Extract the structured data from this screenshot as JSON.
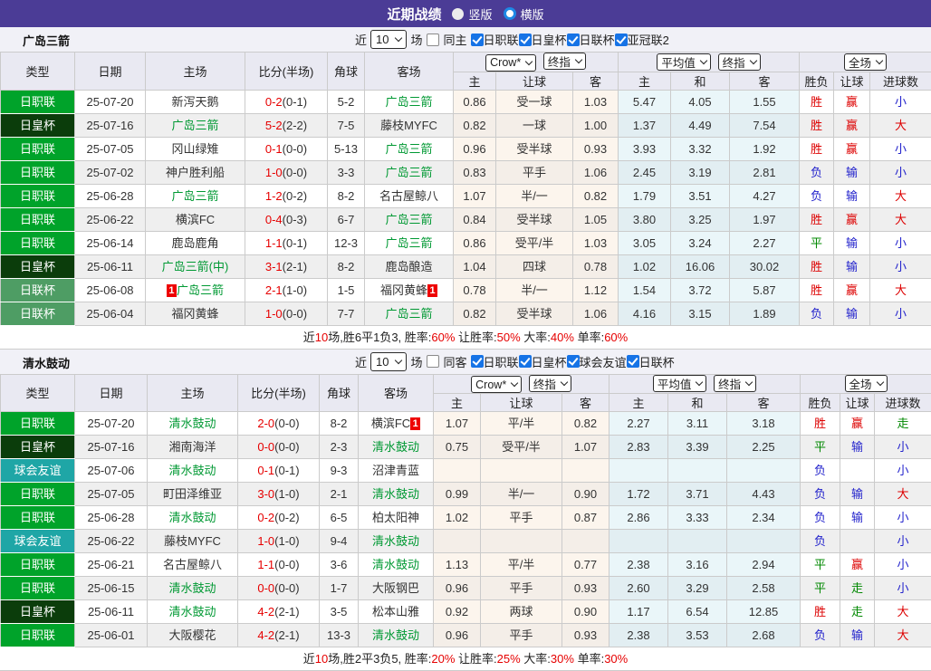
{
  "header": {
    "title": "近期战绩",
    "radio_vertical": "竖版",
    "radio_horizontal": "横版"
  },
  "labels": {
    "near": "近",
    "games": "场"
  },
  "league_colors": {
    "日职联": "#00A32A",
    "日皇杯": "#0B3D0B",
    "日联杯": "#4E9D64",
    "球会友谊": "#1FA6A6"
  },
  "result_colors": {
    "胜": "#DD0000",
    "赢": "#DD0000",
    "大": "#DD0000",
    "负": "#2222CC",
    "输": "#2222CC",
    "小": "#2222CC",
    "平": "#008800",
    "走": "#008800"
  },
  "table_head": {
    "match_cols": [
      "类型",
      "日期",
      "主场",
      "比分(半场)",
      "角球",
      "客场"
    ],
    "odds_selects": {
      "crow": "Crow*",
      "crow_final": "终指",
      "avg": "平均值",
      "avg_final": "终指",
      "full": "全场"
    },
    "sub_cols": [
      "主",
      "让球",
      "客",
      "主",
      "和",
      "客",
      "胜负",
      "让球",
      "进球数"
    ]
  },
  "sections": [
    {
      "team": "广岛三箭",
      "filter": {
        "count": "10",
        "same_label": "同主",
        "leagues": [
          "日职联",
          "日皇杯",
          "日联杯",
          "亚冠联2"
        ]
      },
      "rows": [
        {
          "league": "日职联",
          "date": "25-07-20",
          "home": {
            "name": "新泻天鹅"
          },
          "score": {
            "ft": "0-2",
            "ht": "(0-1)"
          },
          "corner": "5-2",
          "away": {
            "name": "广岛三箭",
            "focus": true
          },
          "crow": [
            "0.86",
            "受一球",
            "1.03"
          ],
          "avg": [
            "5.47",
            "4.05",
            "1.55"
          ],
          "result": [
            "胜",
            "赢",
            "小"
          ]
        },
        {
          "league": "日皇杯",
          "date": "25-07-16",
          "home": {
            "name": "广岛三箭",
            "focus": true
          },
          "score": {
            "ft": "5-2",
            "ht": "(2-2)"
          },
          "corner": "7-5",
          "away": {
            "name": "藤枝MYFC"
          },
          "crow": [
            "0.82",
            "一球",
            "1.00"
          ],
          "avg": [
            "1.37",
            "4.49",
            "7.54"
          ],
          "result": [
            "胜",
            "赢",
            "大"
          ]
        },
        {
          "league": "日职联",
          "date": "25-07-05",
          "home": {
            "name": "冈山绿雉"
          },
          "score": {
            "ft": "0-1",
            "ht": "(0-0)"
          },
          "corner": "5-13",
          "away": {
            "name": "广岛三箭",
            "focus": true
          },
          "crow": [
            "0.96",
            "受半球",
            "0.93"
          ],
          "avg": [
            "3.93",
            "3.32",
            "1.92"
          ],
          "result": [
            "胜",
            "赢",
            "小"
          ]
        },
        {
          "league": "日职联",
          "date": "25-07-02",
          "home": {
            "name": "神户胜利船"
          },
          "score": {
            "ft": "1-0",
            "ht": "(0-0)"
          },
          "corner": "3-3",
          "away": {
            "name": "广岛三箭",
            "focus": true
          },
          "crow": [
            "0.83",
            "平手",
            "1.06"
          ],
          "avg": [
            "2.45",
            "3.19",
            "2.81"
          ],
          "result": [
            "负",
            "输",
            "小"
          ]
        },
        {
          "league": "日职联",
          "date": "25-06-28",
          "home": {
            "name": "广岛三箭",
            "focus": true
          },
          "score": {
            "ft": "1-2",
            "ht": "(0-2)"
          },
          "corner": "8-2",
          "away": {
            "name": "名古屋鲸八"
          },
          "crow": [
            "1.07",
            "半/一",
            "0.82"
          ],
          "avg": [
            "1.79",
            "3.51",
            "4.27"
          ],
          "result": [
            "负",
            "输",
            "大"
          ]
        },
        {
          "league": "日职联",
          "date": "25-06-22",
          "home": {
            "name": "横滨FC"
          },
          "score": {
            "ft": "0-4",
            "ht": "(0-3)"
          },
          "corner": "6-7",
          "away": {
            "name": "广岛三箭",
            "focus": true
          },
          "crow": [
            "0.84",
            "受半球",
            "1.05"
          ],
          "avg": [
            "3.80",
            "3.25",
            "1.97"
          ],
          "result": [
            "胜",
            "赢",
            "大"
          ]
        },
        {
          "league": "日职联",
          "date": "25-06-14",
          "home": {
            "name": "鹿岛鹿角"
          },
          "score": {
            "ft": "1-1",
            "ht": "(0-1)"
          },
          "corner": "12-3",
          "away": {
            "name": "广岛三箭",
            "focus": true
          },
          "crow": [
            "0.86",
            "受平/半",
            "1.03"
          ],
          "avg": [
            "3.05",
            "3.24",
            "2.27"
          ],
          "result": [
            "平",
            "输",
            "小"
          ]
        },
        {
          "league": "日皇杯",
          "date": "25-06-11",
          "home": {
            "name": "广岛三箭(中)",
            "focus": true
          },
          "score": {
            "ft": "3-1",
            "ht": "(2-1)"
          },
          "corner": "8-2",
          "away": {
            "name": "鹿岛酿造"
          },
          "crow": [
            "1.04",
            "四球",
            "0.78"
          ],
          "avg": [
            "1.02",
            "16.06",
            "30.02"
          ],
          "result": [
            "胜",
            "输",
            "小"
          ]
        },
        {
          "league": "日联杯",
          "date": "25-06-08",
          "home": {
            "name": "广岛三箭",
            "focus": true,
            "badge_before": "1"
          },
          "score": {
            "ft": "2-1",
            "ht": "(1-0)"
          },
          "corner": "1-5",
          "away": {
            "name": "福冈黄蜂",
            "badge_after": "1"
          },
          "crow": [
            "0.78",
            "半/一",
            "1.12"
          ],
          "avg": [
            "1.54",
            "3.72",
            "5.87"
          ],
          "result": [
            "胜",
            "赢",
            "大"
          ]
        },
        {
          "league": "日联杯",
          "date": "25-06-04",
          "home": {
            "name": "福冈黄蜂"
          },
          "score": {
            "ft": "1-0",
            "ht": "(0-0)"
          },
          "corner": "7-7",
          "away": {
            "name": "广岛三箭",
            "focus": true
          },
          "crow": [
            "0.82",
            "受半球",
            "1.06"
          ],
          "avg": [
            "4.16",
            "3.15",
            "1.89"
          ],
          "result": [
            "负",
            "输",
            "小"
          ]
        }
      ],
      "summary": [
        "近",
        "10",
        "场,胜6平1负3, 胜率:",
        "60%",
        " 让胜率:",
        "50%",
        " 大率:",
        "40%",
        " 单率:",
        "60%"
      ]
    },
    {
      "team": "清水鼓动",
      "filter": {
        "count": "10",
        "same_label": "同客",
        "leagues": [
          "日职联",
          "日皇杯",
          "球会友谊",
          "日联杯"
        ]
      },
      "rows": [
        {
          "league": "日职联",
          "date": "25-07-20",
          "home": {
            "name": "清水鼓动",
            "focus": true
          },
          "score": {
            "ft": "2-0",
            "ht": "(0-0)"
          },
          "corner": "8-2",
          "away": {
            "name": "横滨FC",
            "badge_after": "1"
          },
          "crow": [
            "1.07",
            "平/半",
            "0.82"
          ],
          "avg": [
            "2.27",
            "3.11",
            "3.18"
          ],
          "result": [
            "胜",
            "赢",
            "走"
          ]
        },
        {
          "league": "日皇杯",
          "date": "25-07-16",
          "home": {
            "name": "湘南海洋"
          },
          "score": {
            "ft": "0-0",
            "ht": "(0-0)"
          },
          "corner": "2-3",
          "away": {
            "name": "清水鼓动",
            "focus": true
          },
          "crow": [
            "0.75",
            "受平/半",
            "1.07"
          ],
          "avg": [
            "2.83",
            "3.39",
            "2.25"
          ],
          "result": [
            "平",
            "输",
            "小"
          ]
        },
        {
          "league": "球会友谊",
          "date": "25-07-06",
          "home": {
            "name": "清水鼓动",
            "focus": true
          },
          "score": {
            "ft": "0-1",
            "ht": "(0-1)"
          },
          "corner": "9-3",
          "away": {
            "name": "沼津青蓝"
          },
          "crow": [
            "",
            "",
            ""
          ],
          "avg": [
            "",
            "",
            ""
          ],
          "result": [
            "负",
            "",
            "小"
          ]
        },
        {
          "league": "日职联",
          "date": "25-07-05",
          "home": {
            "name": "町田泽维亚"
          },
          "score": {
            "ft": "3-0",
            "ht": "(1-0)"
          },
          "corner": "2-1",
          "away": {
            "name": "清水鼓动",
            "focus": true
          },
          "crow": [
            "0.99",
            "半/一",
            "0.90"
          ],
          "avg": [
            "1.72",
            "3.71",
            "4.43"
          ],
          "result": [
            "负",
            "输",
            "大"
          ]
        },
        {
          "league": "日职联",
          "date": "25-06-28",
          "home": {
            "name": "清水鼓动",
            "focus": true
          },
          "score": {
            "ft": "0-2",
            "ht": "(0-2)"
          },
          "corner": "6-5",
          "away": {
            "name": "柏太阳神"
          },
          "crow": [
            "1.02",
            "平手",
            "0.87"
          ],
          "avg": [
            "2.86",
            "3.33",
            "2.34"
          ],
          "result": [
            "负",
            "输",
            "小"
          ]
        },
        {
          "league": "球会友谊",
          "date": "25-06-22",
          "home": {
            "name": "藤枝MYFC"
          },
          "score": {
            "ft": "1-0",
            "ht": "(1-0)"
          },
          "corner": "9-4",
          "away": {
            "name": "清水鼓动",
            "focus": true
          },
          "crow": [
            "",
            "",
            ""
          ],
          "avg": [
            "",
            "",
            ""
          ],
          "result": [
            "负",
            "",
            "小"
          ]
        },
        {
          "league": "日职联",
          "date": "25-06-21",
          "home": {
            "name": "名古屋鲸八"
          },
          "score": {
            "ft": "1-1",
            "ht": "(0-0)"
          },
          "corner": "3-6",
          "away": {
            "name": "清水鼓动",
            "focus": true
          },
          "crow": [
            "1.13",
            "平/半",
            "0.77"
          ],
          "avg": [
            "2.38",
            "3.16",
            "2.94"
          ],
          "result": [
            "平",
            "赢",
            "小"
          ]
        },
        {
          "league": "日职联",
          "date": "25-06-15",
          "home": {
            "name": "清水鼓动",
            "focus": true
          },
          "score": {
            "ft": "0-0",
            "ht": "(0-0)"
          },
          "corner": "1-7",
          "away": {
            "name": "大阪钢巴"
          },
          "crow": [
            "0.96",
            "平手",
            "0.93"
          ],
          "avg": [
            "2.60",
            "3.29",
            "2.58"
          ],
          "result": [
            "平",
            "走",
            "小"
          ]
        },
        {
          "league": "日皇杯",
          "date": "25-06-11",
          "home": {
            "name": "清水鼓动",
            "focus": true
          },
          "score": {
            "ft": "4-2",
            "ht": "(2-1)"
          },
          "corner": "3-5",
          "away": {
            "name": "松本山雅"
          },
          "crow": [
            "0.92",
            "两球",
            "0.90"
          ],
          "avg": [
            "1.17",
            "6.54",
            "12.85"
          ],
          "result": [
            "胜",
            "走",
            "大"
          ]
        },
        {
          "league": "日职联",
          "date": "25-06-01",
          "home": {
            "name": "大阪樱花"
          },
          "score": {
            "ft": "4-2",
            "ht": "(2-1)"
          },
          "corner": "13-3",
          "away": {
            "name": "清水鼓动",
            "focus": true
          },
          "crow": [
            "0.96",
            "平手",
            "0.93"
          ],
          "avg": [
            "2.38",
            "3.53",
            "2.68"
          ],
          "result": [
            "负",
            "输",
            "大"
          ]
        }
      ],
      "summary": [
        "近",
        "10",
        "场,胜2平3负5, 胜率:",
        "20%",
        " 让胜率:",
        "25%",
        " 大率:",
        "30%",
        " 单率:",
        "30%"
      ]
    }
  ]
}
